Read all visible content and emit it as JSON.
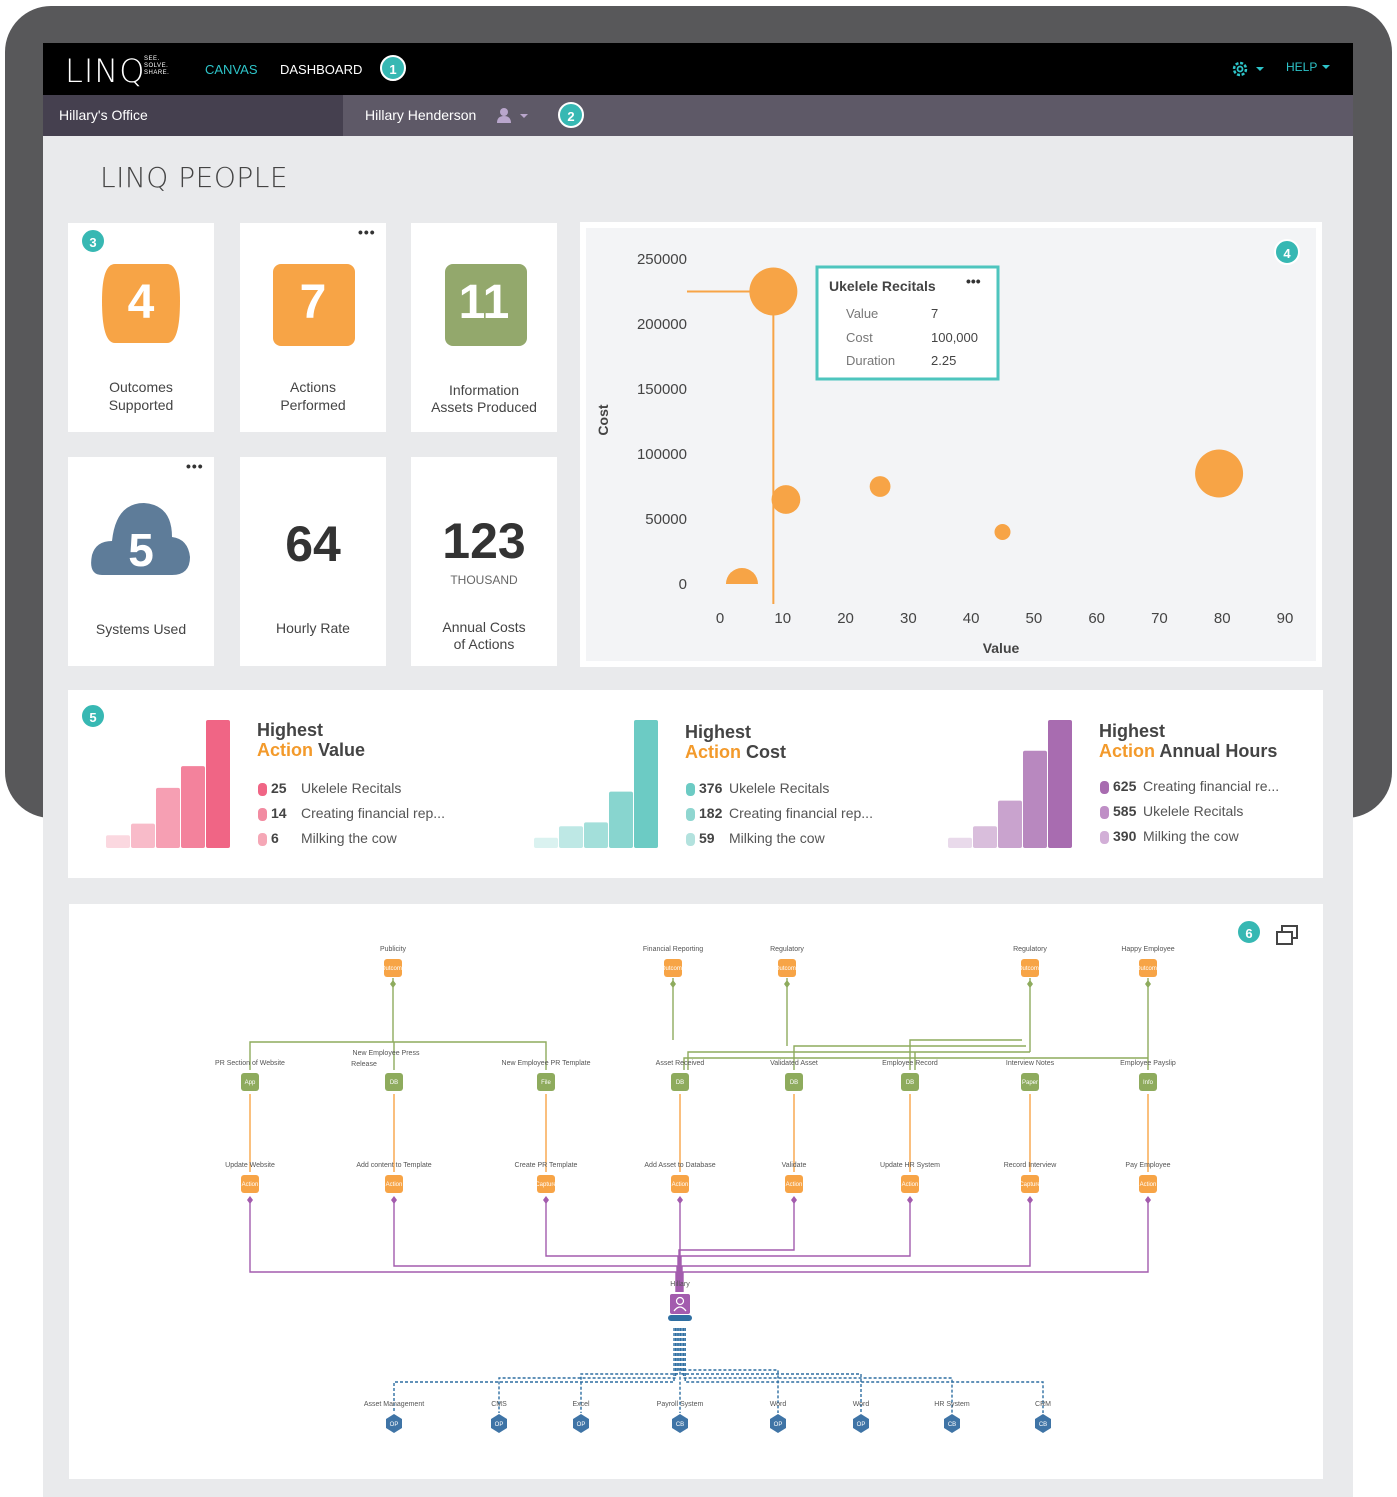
{
  "nav": {
    "logo": "LINQ",
    "logo_tagline": [
      "SEE.",
      "SOLVE.",
      "SHARE."
    ],
    "canvas": "CANVAS",
    "dashboard": "DASHBOARD",
    "help": "HELP",
    "badge1": "1"
  },
  "subnav": {
    "office": "Hillary's Office",
    "user": "Hillary Henderson",
    "badge2": "2"
  },
  "page_title": "LINQ PEOPLE",
  "kpis": {
    "badge3": "3",
    "outcomes": {
      "value": "4",
      "label1": "Outcomes",
      "label2": "Supported",
      "color": "#f7a446"
    },
    "actions": {
      "value": "7",
      "label1": "Actions",
      "label2": "Performed",
      "color": "#f7a446"
    },
    "info_assets": {
      "value": "11",
      "label1": "Information",
      "label2": "Assets Produced",
      "color": "#93a86c"
    },
    "systems": {
      "value": "5",
      "label": "Systems Used",
      "color": "#5e7c99"
    },
    "hourly": {
      "value": "64",
      "label": "Hourly Rate"
    },
    "annual": {
      "value": "123",
      "unit": "THOUSAND",
      "label1": "Annual Costs",
      "label2": "of Actions"
    },
    "menu_dots": "•••"
  },
  "chart_data": {
    "type": "scatter",
    "badge4": "4",
    "xlabel": "Value",
    "ylabel": "Cost",
    "xlim": [
      0,
      90
    ],
    "ylim": [
      0,
      250000
    ],
    "x_ticks": [
      "0",
      "10",
      "20",
      "30",
      "40",
      "50",
      "60",
      "70",
      "80",
      "90"
    ],
    "y_ticks": [
      "0",
      "50000",
      "100000",
      "150000",
      "200000",
      "250000"
    ],
    "color": "#f7a446",
    "points": [
      {
        "x": 3.5,
        "y": 0,
        "size": 2.0
      },
      {
        "x": 8.5,
        "y": 225000,
        "size": 3.0
      },
      {
        "x": 10.5,
        "y": 65000,
        "size": 1.8
      },
      {
        "x": 25.5,
        "y": 75000,
        "size": 1.3
      },
      {
        "x": 45,
        "y": 40000,
        "size": 1.0
      },
      {
        "x": 79.5,
        "y": 85000,
        "size": 3.0
      }
    ],
    "tooltip": {
      "title": "Ukelele Recitals",
      "rows": [
        {
          "k": "Value",
          "v": "7"
        },
        {
          "k": "Cost",
          "v": "100,000"
        },
        {
          "k": "Duration",
          "v": "2.25"
        }
      ]
    }
  },
  "highlights": {
    "badge5": "5",
    "panels": [
      {
        "title": "Highest",
        "accent": "Action",
        "rest": "Value",
        "color": "#f06585",
        "bars": [
          0.1,
          0.19,
          0.47,
          0.64,
          1.0
        ],
        "items": [
          {
            "num": "25",
            "text": "Ukelele Recitals"
          },
          {
            "num": "14",
            "text": "Creating financial rep..."
          },
          {
            "num": "6",
            "text": "Milking the cow"
          }
        ]
      },
      {
        "title": "Highest",
        "accent": "Action",
        "rest": "Cost",
        "color": "#6ccbc4",
        "bars": [
          0.08,
          0.17,
          0.2,
          0.44,
          1.0
        ],
        "items": [
          {
            "num": "376",
            "text": "Ukelele Recitals"
          },
          {
            "num": "182",
            "text": "Creating financial rep..."
          },
          {
            "num": "59",
            "text": "Milking the cow"
          }
        ]
      },
      {
        "title": "Highest",
        "accent": "Action",
        "rest": "Annual Hours",
        "color": "#a86cb0",
        "bars": [
          0.08,
          0.17,
          0.37,
          0.76,
          1.0
        ],
        "items": [
          {
            "num": "625",
            "text": "Creating financial re..."
          },
          {
            "num": "585",
            "text": "Ukelele Recitals"
          },
          {
            "num": "390",
            "text": "Milking the cow"
          }
        ]
      }
    ]
  },
  "flow": {
    "badge6": "6",
    "outcomes": [
      {
        "label": "Publicity",
        "tag": "Outcome"
      },
      {
        "label": "Financial Reporting",
        "tag": "Outcome"
      },
      {
        "label": "Regulatory",
        "tag": "Outcome"
      },
      {
        "label": "Regulatory",
        "tag": "Outcome"
      },
      {
        "label": "Happy Employee",
        "tag": "Outcome"
      }
    ],
    "assets": [
      {
        "label": "PR Section of Website",
        "tag": "App"
      },
      {
        "label": "New Employee Press Release",
        "tag": "DB"
      },
      {
        "label": "New Employee PR Template",
        "tag": "File"
      },
      {
        "label": "Asset Received",
        "tag": "DB"
      },
      {
        "label": "Validated Asset",
        "tag": "DB"
      },
      {
        "label": "Employee Record",
        "tag": "DB"
      },
      {
        "label": "Interview Notes",
        "tag": "Paper"
      },
      {
        "label": "Employee Payslip",
        "tag": "Info"
      }
    ],
    "actions": [
      {
        "label": "Update Website",
        "tag": "Action"
      },
      {
        "label": "Add content to Template",
        "tag": "Action"
      },
      {
        "label": "Create PR Template",
        "tag": "Capture"
      },
      {
        "label": "Add Asset to Database",
        "tag": "Action"
      },
      {
        "label": "Validate",
        "tag": "Action"
      },
      {
        "label": "Update HR System",
        "tag": "Action"
      },
      {
        "label": "Record Interview",
        "tag": "Capture"
      },
      {
        "label": "Pay Employee",
        "tag": "Action"
      }
    ],
    "person": "Hillary",
    "systems": [
      {
        "label": "Asset Management",
        "tag": "OP"
      },
      {
        "label": "CMS",
        "tag": "OP"
      },
      {
        "label": "Excel",
        "tag": "OP"
      },
      {
        "label": "Payroll System",
        "tag": "CB"
      },
      {
        "label": "Word",
        "tag": "OP"
      },
      {
        "label": "Word",
        "tag": "OP"
      },
      {
        "label": "HR System",
        "tag": "CB"
      },
      {
        "label": "CRM",
        "tag": "CB"
      }
    ]
  }
}
